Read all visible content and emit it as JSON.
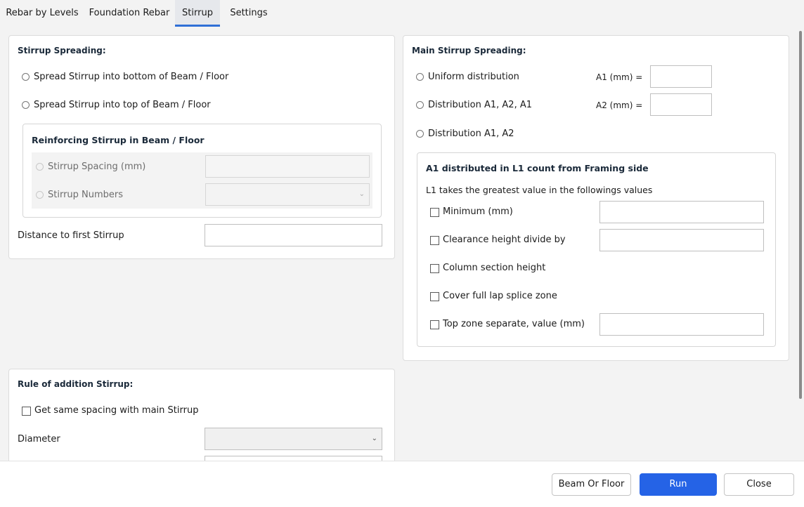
{
  "tabs": [
    "Rebar by Levels",
    "Foundation Rebar",
    "Stirrup",
    "Settings"
  ],
  "stirrup_spreading": {
    "title": "Stirrup Spreading:",
    "option_bottom": "Spread Stirrup into bottom of Beam / Floor",
    "option_top": "Spread Stirrup into top of Beam / Floor",
    "reinforcing_group": {
      "title": "Reinforcing Stirrup in Beam / Floor",
      "spacing_label": "Stirrup Spacing (mm)",
      "numbers_label": "Stirrup Numbers"
    },
    "distance_label": "Distance to first Stirrup"
  },
  "main_stirrup": {
    "title": "Main Stirrup Spreading:",
    "options": [
      "Uniform distribution",
      "Distribution A1, A2, A1",
      "Distribution A1, A2"
    ],
    "a1_label": "A1 (mm) =",
    "a2_label": "A2 (mm) =",
    "l1_group": {
      "title": "A1 distributed in L1 count from Framing side",
      "note": "L1 takes the greatest value in the followings values",
      "checks": [
        "Minimum (mm)",
        "Clearance height divide by",
        "Column section height",
        "Cover full lap splice zone",
        "Top zone separate, value (mm)"
      ]
    }
  },
  "addition": {
    "title": "Rule of addition Stirrup:",
    "same_spacing_label": "Get same spacing with main Stirrup",
    "diameter_label": "Diameter"
  },
  "footer": {
    "beam_floor": "Beam Or Floor",
    "run": "Run",
    "close": "Close"
  },
  "colors": {
    "accent": "#2563e6",
    "tab_underline": "#2f6fd6"
  }
}
